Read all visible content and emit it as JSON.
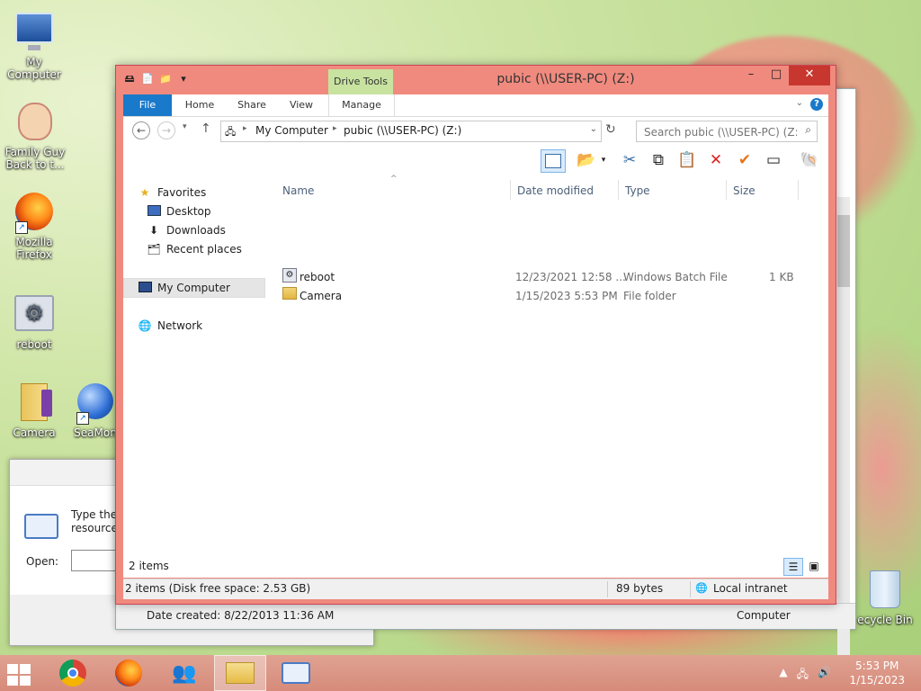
{
  "desktop": {
    "icons": [
      {
        "label": "My Computer"
      },
      {
        "label": "Family Guy Back to t..."
      },
      {
        "label": "Mozilla Firefox"
      },
      {
        "label": "reboot"
      },
      {
        "label": "Camera"
      },
      {
        "label": "SeaMon"
      },
      {
        "label": "ecycle Bin"
      }
    ]
  },
  "run_dialog": {
    "text_line1": "Type the",
    "text_line2": "resource,",
    "open_label": "Open:"
  },
  "behind_window": {
    "date_created": "Date created: 8/22/2013 11:36 AM",
    "computer_label": "Computer"
  },
  "window": {
    "title": "pubic (\\\\USER-PC) (Z:)",
    "contextual_tab": "Drive Tools",
    "controls": {
      "minimize": "–",
      "maximize": "□",
      "close": "✕"
    },
    "ribbon_tabs": [
      "File",
      "Home",
      "Share",
      "View",
      "Manage"
    ],
    "address": {
      "crumbs": [
        "My Computer",
        "pubic (\\\\USER-PC) (Z:)"
      ],
      "search_placeholder": "Search pubic (\\\\USER-PC) (Z:)"
    },
    "nav": {
      "favorites": "Favorites",
      "favorites_items": [
        "Desktop",
        "Downloads",
        "Recent places"
      ],
      "my_computer": "My Computer",
      "network": "Network"
    },
    "columns": [
      "Name",
      "Date modified",
      "Type",
      "Size"
    ],
    "files": [
      {
        "name": "reboot",
        "date": "12/23/2021 12:58 ...",
        "type": "Windows Batch File",
        "size": "1 KB"
      },
      {
        "name": "Camera",
        "date": "1/15/2023 5:53 PM",
        "type": "File folder",
        "size": ""
      }
    ],
    "status": {
      "items_count": "2 items",
      "details_left": "2 items (Disk free space: 2.53 GB)",
      "details_size": "89 bytes",
      "details_zone": "Local intranet"
    }
  },
  "taskbar": {
    "time": "5:53 PM",
    "date": "1/15/2023"
  },
  "colors": {
    "title_bar": "#f08a7e",
    "close_button": "#c7372f",
    "file_tab": "#1979ca",
    "drive_tools": "#c8e2a0",
    "taskbar": "#d68b7a"
  }
}
